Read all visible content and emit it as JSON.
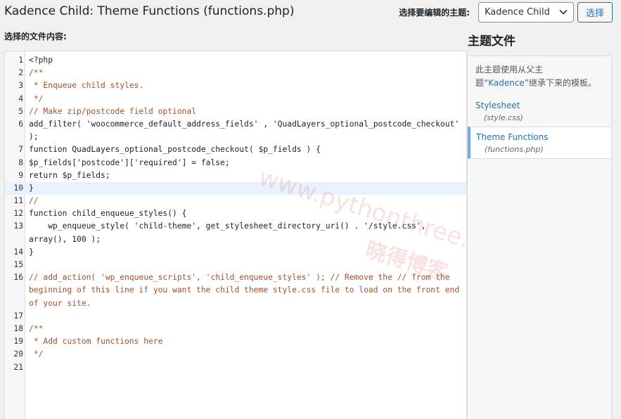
{
  "page": {
    "title": "Kadence Child: Theme Functions (functions.php)"
  },
  "picker": {
    "label": "选择要编辑的主题:",
    "selected_theme": "Kadence Child",
    "select_button": "选择"
  },
  "editor": {
    "label": "选择的文件内容:",
    "lines": [
      {
        "n": "1",
        "text": "<?php",
        "style": "plain"
      },
      {
        "n": "2",
        "text": "/**",
        "style": "comment"
      },
      {
        "n": "3",
        "text": " * Enqueue child styles.",
        "style": "comment"
      },
      {
        "n": "4",
        "text": " */",
        "style": "comment"
      },
      {
        "n": "5",
        "text": "// Make zip/postcode field optional",
        "style": "comment"
      },
      {
        "n": "6",
        "text": "add_filter( 'woocommerce_default_address_fields' , 'QuadLayers_optional_postcode_checkout' );",
        "style": "plain"
      },
      {
        "n": "7",
        "text": "function QuadLayers_optional_postcode_checkout( $p_fields ) {",
        "style": "plain"
      },
      {
        "n": "8",
        "text": "$p_fields['postcode']['required'] = false;",
        "style": "plain"
      },
      {
        "n": "9",
        "text": "return $p_fields;",
        "style": "plain"
      },
      {
        "n": "10",
        "text": "}",
        "style": "plain"
      },
      {
        "n": "11",
        "text": "//",
        "style": "comment"
      },
      {
        "n": "12",
        "text": "function child_enqueue_styles() {",
        "style": "plain"
      },
      {
        "n": "13",
        "text": "    wp_enqueue_style( 'child-theme', get_stylesheet_directory_uri() . '/style.css', array(), 100 );",
        "style": "plain"
      },
      {
        "n": "14",
        "text": "}",
        "style": "plain"
      },
      {
        "n": "15",
        "text": "",
        "style": "plain"
      },
      {
        "n": "16",
        "text": "// add_action( 'wp_enqueue_scripts', 'child_enqueue_styles' ); // Remove the // from the beginning of this line if you want the child theme style.css file to load on the front end of your site.",
        "style": "comment"
      },
      {
        "n": "17",
        "text": "",
        "style": "plain"
      },
      {
        "n": "18",
        "text": "/**",
        "style": "comment"
      },
      {
        "n": "19",
        "text": " * Add custom functions here",
        "style": "comment"
      },
      {
        "n": "20",
        "text": " */",
        "style": "comment"
      },
      {
        "n": "21",
        "text": "",
        "style": "plain"
      }
    ],
    "active_line": "10"
  },
  "watermark": {
    "line1": "www.pythonthree.com",
    "line2": "晓得博客"
  },
  "sidebar": {
    "title": "主题文件",
    "note_prefix": "此主题使用从父主题“",
    "note_parent": "Kadence",
    "note_suffix": "”继承下来的模板。",
    "files": [
      {
        "name": "Stylesheet",
        "path": "(style.css)"
      },
      {
        "name": "Theme Functions",
        "path": "(functions.php)"
      }
    ]
  }
}
